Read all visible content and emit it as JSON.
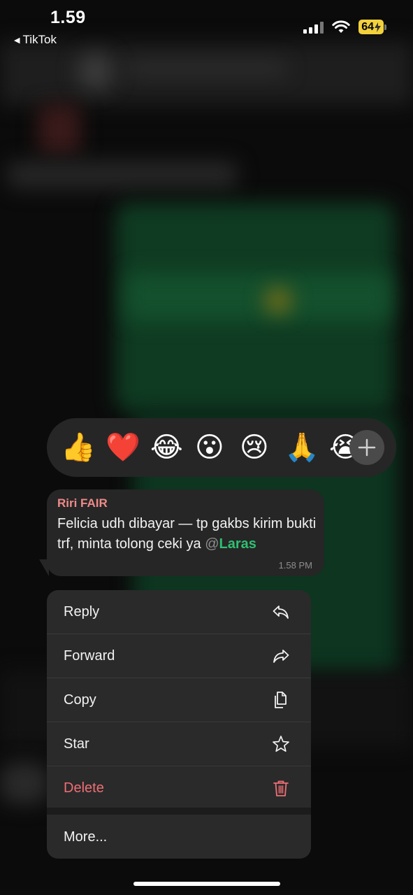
{
  "status_bar": {
    "time": "1.59",
    "back_app": "TikTok",
    "battery_level": "64"
  },
  "reactions": {
    "emojis": [
      "👍",
      "❤️",
      "😂",
      "😮",
      "😢",
      "🙏",
      "😭"
    ],
    "add_icon": "plus-icon"
  },
  "message": {
    "sender": "Riri FAIR",
    "text": "Felicia udh dibayar — tp gakbs kirim bukti trf, minta tolong ceki ya ",
    "mention_at": "@",
    "mention_name": "Laras",
    "time": "1.58 PM"
  },
  "menu": {
    "items": [
      {
        "label": "Reply",
        "icon": "reply-icon"
      },
      {
        "label": "Forward",
        "icon": "forward-icon"
      },
      {
        "label": "Copy",
        "icon": "copy-icon"
      },
      {
        "label": "Star",
        "icon": "star-icon"
      },
      {
        "label": "Delete",
        "icon": "trash-icon"
      }
    ],
    "more_label": "More..."
  },
  "colors": {
    "sender": "#f08a8a",
    "mention": "#2fbf71",
    "danger": "#ef6f75",
    "battery": "#f2d13c"
  }
}
